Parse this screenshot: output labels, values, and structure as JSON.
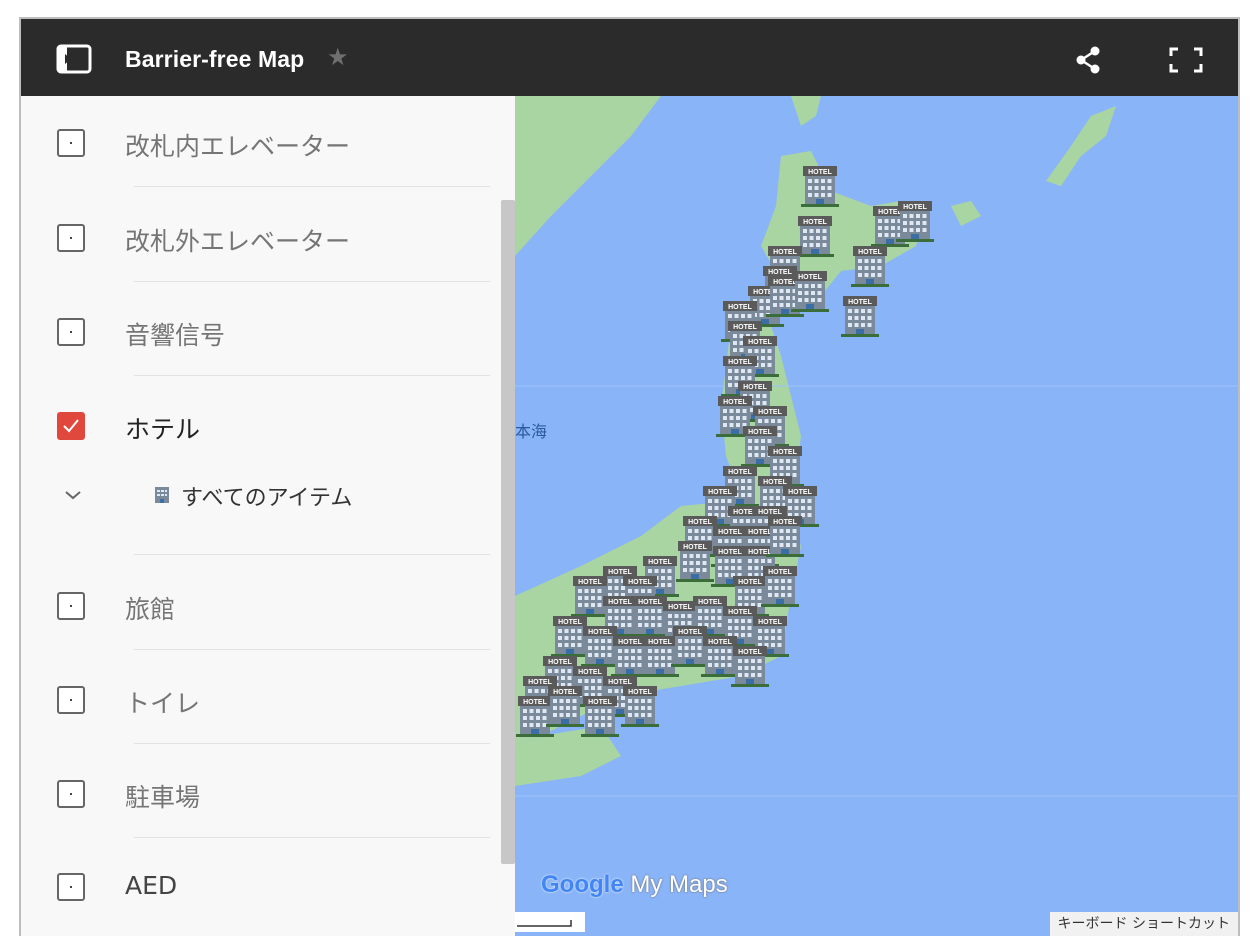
{
  "topbar": {
    "title": "Barrier-free Map",
    "icons": {
      "panel": "side-panel-icon",
      "star": "star-icon",
      "share": "share-icon",
      "fullscreen": "fullscreen-icon"
    }
  },
  "layers": [
    {
      "label": "改札内エレベーター",
      "checked": false
    },
    {
      "label": "改札外エレベーター",
      "checked": false
    },
    {
      "label": "音響信号",
      "checked": false
    },
    {
      "label": "ホテル",
      "checked": true,
      "sub_item": "すべてのアイテム"
    },
    {
      "label": "旅館",
      "checked": false
    },
    {
      "label": "トイレ",
      "checked": false
    },
    {
      "label": "駐車場",
      "checked": false
    },
    {
      "label": "AED",
      "checked": false
    }
  ],
  "map": {
    "sea_label": "本海",
    "marker_label": "HOTEL",
    "watermark_google": "Google",
    "watermark_mymaps": "My Maps",
    "keyboard_shortcuts": "キーボード ショートカット"
  },
  "colors": {
    "topbar": "#2b2b2b",
    "sea": "#8ab4f8",
    "land": "#a8d5a2",
    "checkbox_checked": "#e0473d",
    "marker_building": "#7a8a9a",
    "marker_sign": "#5a5a5a"
  }
}
